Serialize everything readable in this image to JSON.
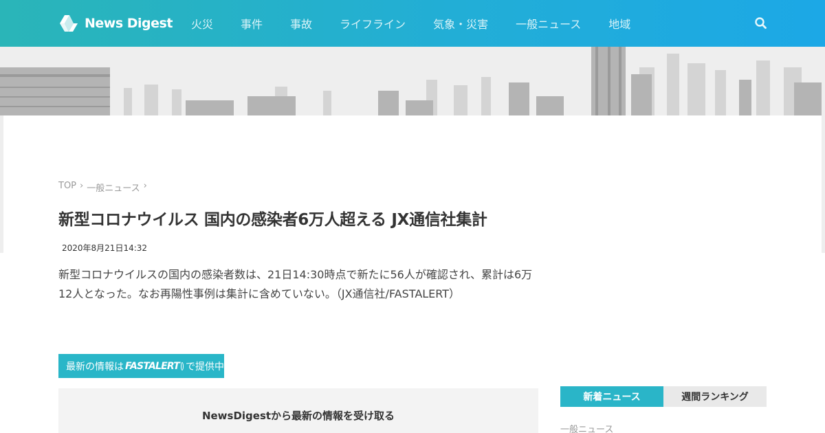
{
  "header": {
    "logo_text": "News Digest",
    "nav": [
      "火災",
      "事件",
      "事故",
      "ライフライン",
      "気象・災害",
      "一般ニュース",
      "地域"
    ],
    "colors": {
      "gradient_start": "#2ab5b8",
      "gradient_end": "#1ca8e6",
      "nav_text": "#d9f3f8"
    },
    "search_icon": "search-icon"
  },
  "breadcrumb": [
    "TOP",
    "›",
    "一般ニュース",
    "›"
  ],
  "article": {
    "title": "新型コロナウイルス 国内の感染者6万人超える JX通信社集計",
    "date": "2020年8月21日14:32",
    "body": "新型コロナウイルスの国内の感染者数は、21日14:30時点で新たに56人が確認され、累計は6万12人となった。なお再陽性事例は集計に含めていない。（JX通信社/FASTALERT）"
  },
  "fastalert_banner": {
    "prefix": "最新の情報は",
    "logo": "FASTALERT",
    "suffix": "で提供中",
    "color": "#29b6c8"
  },
  "subscribe": {
    "text": "NewsDigestから最新の情報を受け取る"
  },
  "sidebar": {
    "tabs": [
      "新着ニュース",
      "週間ランキング"
    ],
    "active_tab": "新着ニュース",
    "category": "一般ニュース"
  }
}
